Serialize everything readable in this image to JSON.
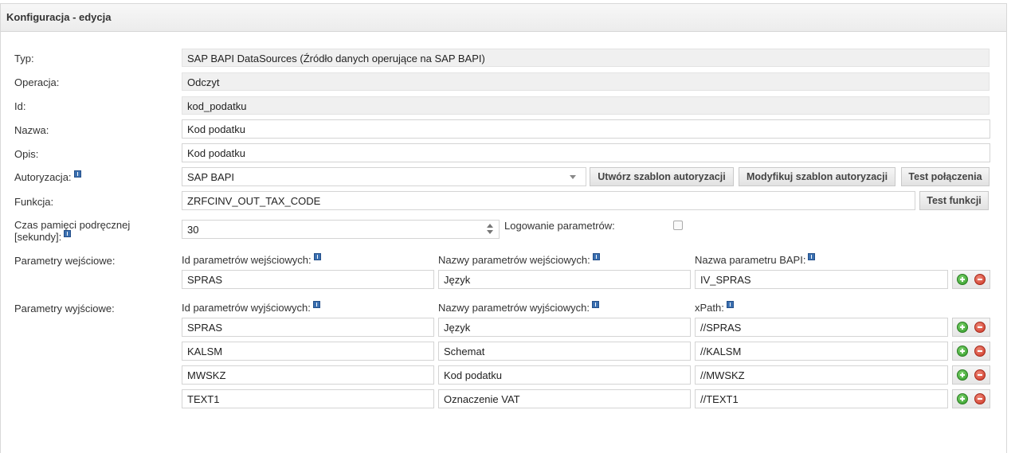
{
  "panel": {
    "title": "Konfiguracja - edycja"
  },
  "labels": {
    "typ": "Typ:",
    "operacja": "Operacja:",
    "id": "Id:",
    "nazwa": "Nazwa:",
    "opis": "Opis:",
    "autoryzacja": "Autoryzacja:",
    "funkcja": "Funkcja:",
    "czas_line1": "Czas pamięci podręcznej",
    "czas_line2": "[sekundy]:",
    "logowanie": "Logowanie parametrów:",
    "parametry_wejsciowe": "Parametry wejściowe:",
    "parametry_wyjsciowe": "Parametry wyjściowe:"
  },
  "values": {
    "typ": "SAP BAPI DataSources (Źródło danych operujące na SAP BAPI)",
    "operacja": "Odczyt",
    "id": "kod_podatku",
    "nazwa": "Kod podatku",
    "opis": "Kod podatku",
    "autoryzacja": "SAP BAPI",
    "funkcja": "ZRFCINV_OUT_TAX_CODE",
    "czas": "30",
    "logowanie_checked": false
  },
  "buttons": {
    "utworz": "Utwórz szablon autoryzacji",
    "modyfikuj": "Modyfikuj szablon autoryzacji",
    "test_polaczenia": "Test połączenia",
    "test_funkcji": "Test funkcji"
  },
  "input_params": {
    "col1": "Id parametrów wejściowych:",
    "col2": "Nazwy parametrów wejściowych:",
    "col3": "Nazwa parametru BAPI:",
    "rows": [
      {
        "id": "SPRAS",
        "name": "Język",
        "bapi": "IV_SPRAS"
      }
    ]
  },
  "output_params": {
    "col1": "Id parametrów wyjściowych:",
    "col2": "Nazwy parametrów wyjściowych:",
    "col3": "xPath:",
    "rows": [
      {
        "id": "SPRAS",
        "name": "Język",
        "xpath": "//SPRAS"
      },
      {
        "id": "KALSM",
        "name": "Schemat",
        "xpath": "//KALSM"
      },
      {
        "id": "MWSKZ",
        "name": "Kod podatku",
        "xpath": "//MWSKZ"
      },
      {
        "id": "TEXT1",
        "name": "Oznaczenie VAT",
        "xpath": "//TEXT1"
      }
    ]
  }
}
